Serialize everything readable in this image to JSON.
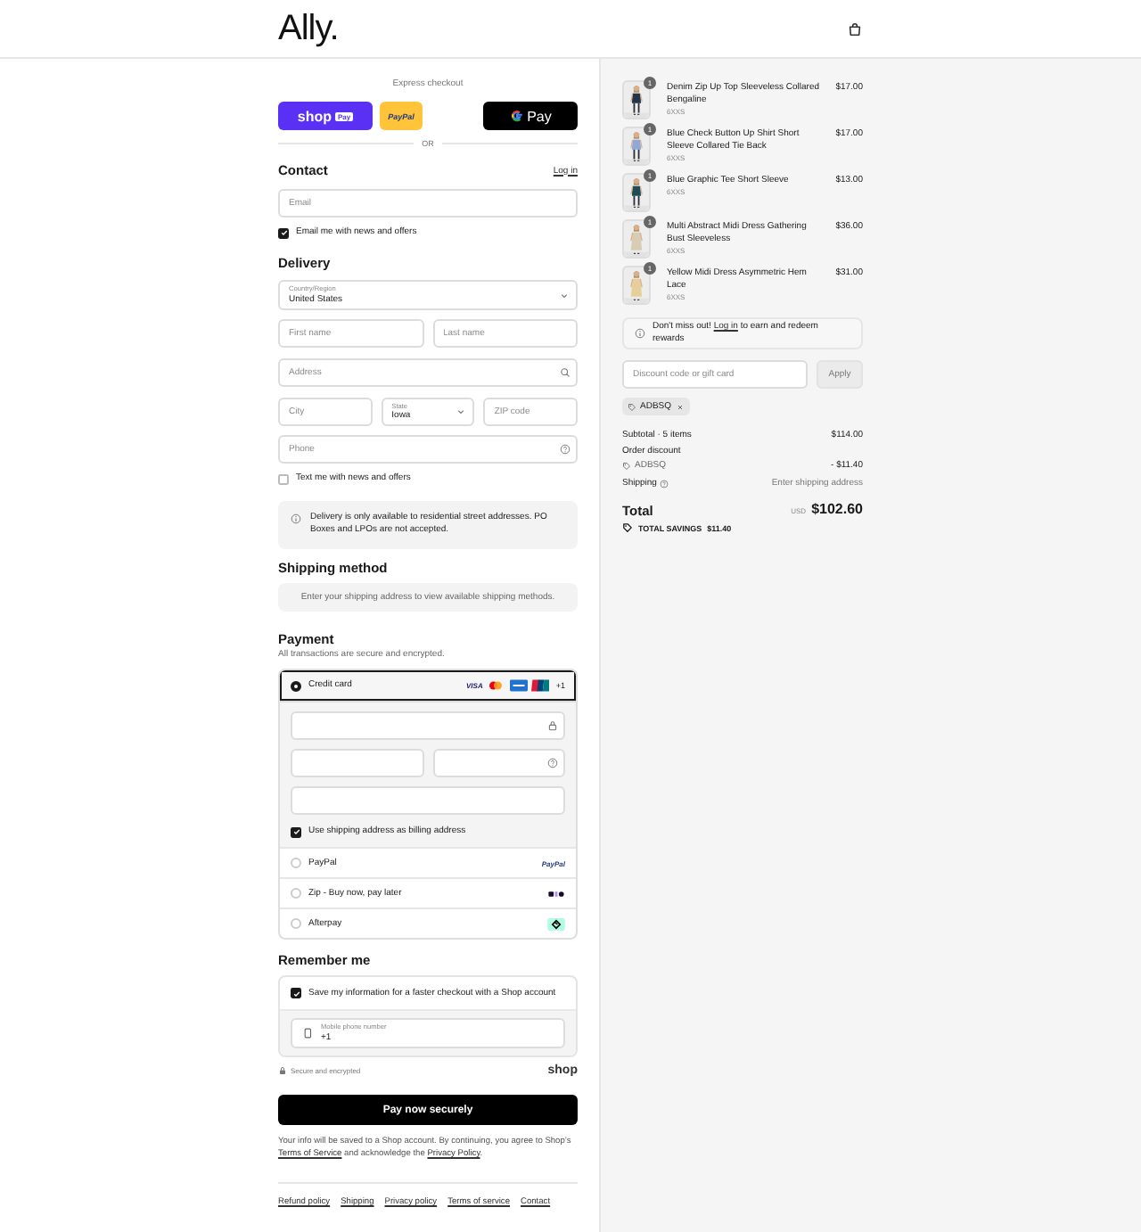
{
  "header": {
    "logo": "Ally."
  },
  "express_checkout": {
    "title": "Express checkout",
    "divider": "OR",
    "buttons": [
      {
        "kind": "shop_pay",
        "label": "shop",
        "badge": "Pay"
      },
      {
        "kind": "paypal",
        "label": "PayPal"
      },
      {
        "kind": "gpay",
        "label": "Pay"
      }
    ]
  },
  "contact": {
    "heading": "Contact",
    "login_link": "Log in",
    "email": {
      "placeholder": "Email"
    },
    "newsletter": {
      "label": "Email me with news and offers",
      "checked": true
    }
  },
  "delivery": {
    "heading": "Delivery",
    "country": {
      "label": "Country/Region",
      "value": "United States"
    },
    "first_name": {
      "placeholder": "First name"
    },
    "last_name": {
      "placeholder": "Last name"
    },
    "address": {
      "placeholder": "Address"
    },
    "city": {
      "placeholder": "City"
    },
    "state": {
      "label": "State",
      "value": "Iowa"
    },
    "zip": {
      "placeholder": "ZIP code"
    },
    "phone": {
      "placeholder": "Phone"
    },
    "sms": {
      "label": "Text me with news and offers",
      "checked": false
    },
    "notice": "Delivery is only available to residential street addresses. PO Boxes and LPOs are not accepted."
  },
  "shipping_method": {
    "heading": "Shipping method",
    "message": "Enter your shipping address to view available shipping methods."
  },
  "payment": {
    "heading": "Payment",
    "subtitle": "All transactions are secure and encrypted.",
    "methods": [
      {
        "kind": "card",
        "label": "Credit card",
        "selected": true,
        "brands": [
          {
            "kind": "visa",
            "label": "VISA"
          },
          {
            "kind": "mastercard"
          },
          {
            "kind": "amex"
          },
          {
            "kind": "unionpay"
          }
        ],
        "more": "+1",
        "billing_same": {
          "label": "Use shipping address as billing address",
          "checked": true
        }
      },
      {
        "kind": "paypal",
        "label": "PayPal",
        "selected": false,
        "logo": "PayPal"
      },
      {
        "kind": "zip",
        "label": "Zip - Buy now, pay later",
        "selected": false
      },
      {
        "kind": "afterpay",
        "label": "Afterpay",
        "selected": false
      }
    ]
  },
  "remember_me": {
    "heading": "Remember me",
    "save": {
      "label": "Save my information for a faster checkout with a Shop account",
      "checked": true
    },
    "mobile": {
      "label": "Mobile phone number",
      "value": "+1"
    },
    "secure_note": "Secure and encrypted",
    "shop_logo": "shop"
  },
  "pay_button": "Pay now securely",
  "legal": [
    {
      "kind": "text",
      "text": "Your info will be saved to a Shop account. By continuing, you agree to Shop’s "
    },
    {
      "kind": "link",
      "text": "Terms of Service"
    },
    {
      "kind": "text",
      "text": " and acknowledge the "
    },
    {
      "kind": "link",
      "text": "Privacy Policy"
    },
    {
      "kind": "text",
      "text": "."
    }
  ],
  "footer_links": [
    "Refund policy",
    "Shipping",
    "Privacy policy",
    "Terms of service",
    "Contact"
  ],
  "summary": {
    "items": [
      {
        "title": "Denim Zip Up Top Sleeveless Collared Bengaline",
        "variant": "6XXS",
        "quantity": "1",
        "price": "$17.00"
      },
      {
        "title": "Blue Check Button Up Shirt Short Sleeve Collared Tie Back",
        "variant": "6XXS",
        "quantity": "1",
        "price": "$17.00"
      },
      {
        "title": "Blue Graphic Tee Short Sleeve",
        "variant": "6XXS",
        "quantity": "1",
        "price": "$13.00"
      },
      {
        "title": "Multi Abstract Midi Dress Gathering Bust Sleeveless",
        "variant": "6XXS",
        "quantity": "1",
        "price": "$36.00"
      },
      {
        "title": "Yellow Midi Dress Asymmetric Hem Lace",
        "variant": "6XXS",
        "quantity": "1",
        "price": "$31.00"
      }
    ],
    "rewards": [
      {
        "kind": "text",
        "text": "Don't miss out! "
      },
      {
        "kind": "link",
        "text": "Log in"
      },
      {
        "kind": "text",
        "text": " to earn and redeem rewards"
      }
    ],
    "discount": {
      "placeholder": "Discount code or gift card",
      "button": "Apply"
    },
    "applied_code": "ADBSQ",
    "subtotal": {
      "label": "Subtotal · 5 items",
      "value": "$114.00"
    },
    "order_discount": {
      "label": "Order discount",
      "code": "ADBSQ",
      "value": "- $11.40"
    },
    "shipping": {
      "label": "Shipping",
      "value": "Enter shipping address"
    },
    "total": {
      "label": "Total",
      "currency": "USD",
      "value": "$102.60"
    },
    "savings": {
      "label": "TOTAL SAVINGS",
      "value": "$11.40"
    }
  }
}
